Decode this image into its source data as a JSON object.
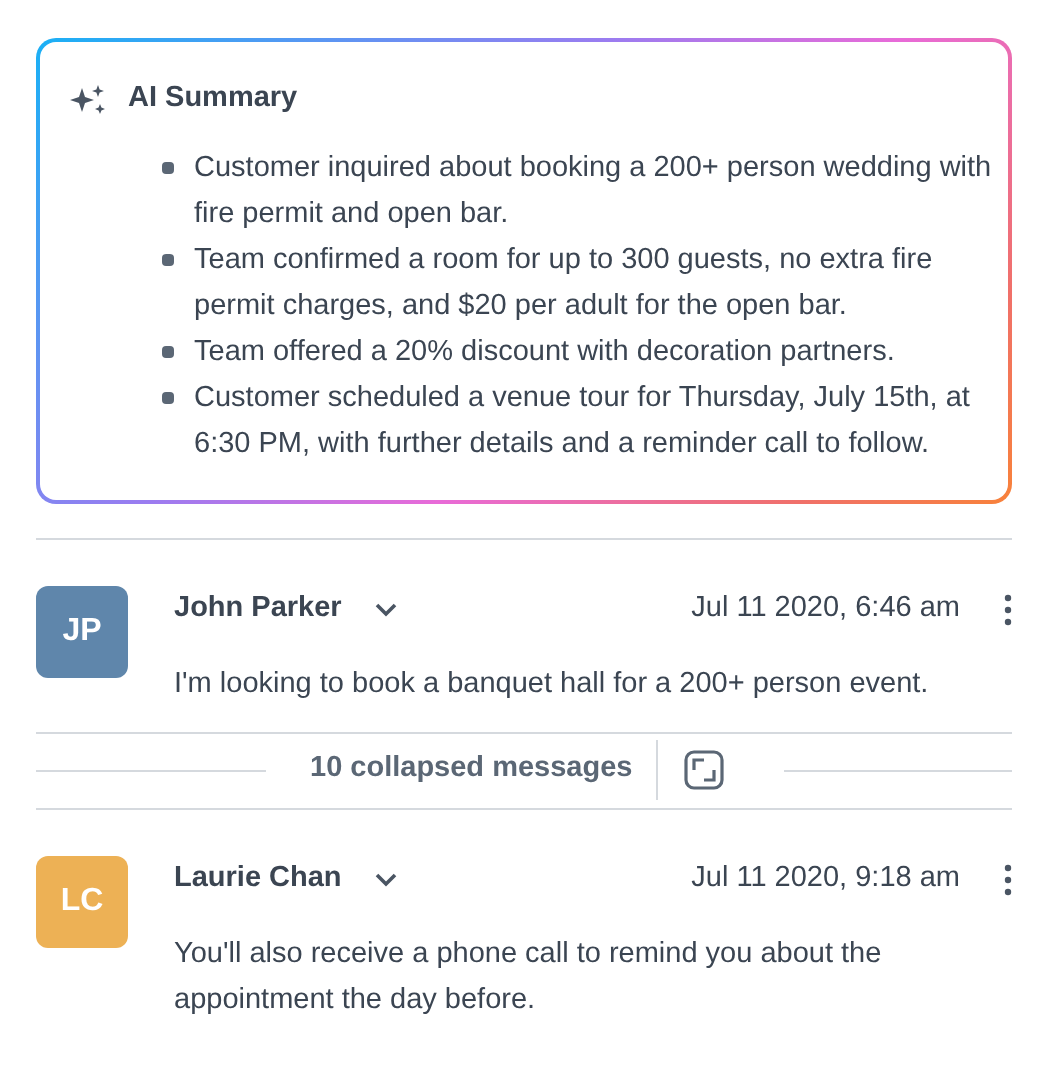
{
  "summary": {
    "title": "AI Summary",
    "bullets": [
      "Customer inquired about booking a 200+ person wedding with fire permit and open bar.",
      "Team confirmed a room for up to 300 guests, no extra fire permit charges, and $20 per adult for the open bar.",
      "Team offered a 20% discount with decoration partners.",
      "Customer scheduled a venue tour for Thursday, July 15th, at 6:30 PM, with further details and a reminder call to follow."
    ]
  },
  "thread": [
    {
      "kind": "message",
      "initials": "JP",
      "color": "#5f86ab",
      "name": "John Parker",
      "time": "Jul 11 2020, 6:46 am",
      "body": "I'm looking to book a banquet hall for a 200+ person event."
    },
    {
      "kind": "collapsed",
      "label": "10 collapsed messages"
    },
    {
      "kind": "message",
      "initials": "LC",
      "color": "#edb155",
      "name": "Laurie Chan",
      "time": "Jul 11 2020, 9:18 am",
      "body": "You'll also receive a phone call to remind you about the appointment the day before."
    }
  ]
}
